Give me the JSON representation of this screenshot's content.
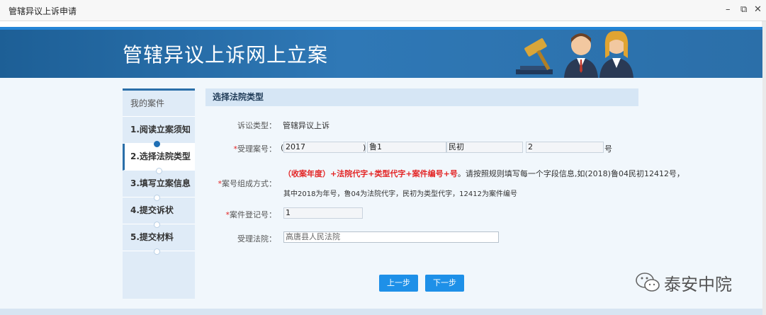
{
  "window": {
    "title": "管辖异议上诉申请",
    "minimize_glyph": "–",
    "restore_glyph": "⧉",
    "close_glyph": "✕"
  },
  "banner": {
    "title": "管辖异议上诉网上立案"
  },
  "sidebar": {
    "heading": "我的案件",
    "steps": [
      {
        "label": "1.阅读立案须知",
        "state": "done"
      },
      {
        "label": "2.选择法院类型",
        "state": "current"
      },
      {
        "label": "3.填写立案信息",
        "state": "pending"
      },
      {
        "label": "4.提交诉状",
        "state": "pending"
      },
      {
        "label": "5.提交材料",
        "state": "pending"
      }
    ]
  },
  "form": {
    "section_title": "选择法院类型",
    "litigation_type": {
      "label": "诉讼类型：",
      "value": "管辖异议上诉"
    },
    "case_number": {
      "label": "受理案号：",
      "open_paren": "(",
      "year": "2017",
      "close_paren": ")",
      "court_code": "鲁1",
      "type_code": "民初",
      "serial": "2",
      "suffix": "号"
    },
    "case_format": {
      "label": "案号组成方式：",
      "rule_red": "（收案年度）+法院代字+类型代字+案件编号+号",
      "rule_black": "。请按照规则填写每一个字段信息,如(2018)鲁04民初12412号，",
      "example": "其中2018为年号，鲁04为法院代字，民初为类型代字，12412为案件编号"
    },
    "registration_no": {
      "label": "案件登记号：",
      "value": "1"
    },
    "court": {
      "label": "受理法院：",
      "value": "高唐县人民法院"
    },
    "required_mark": "*",
    "prev_button": "上一步",
    "next_button": "下一步"
  },
  "watermark": {
    "text": "泰安中院"
  },
  "colors": {
    "banner": "#2b6fa9",
    "accent": "#1e90e8",
    "required": "#e32525",
    "panel": "#dfebf7"
  }
}
